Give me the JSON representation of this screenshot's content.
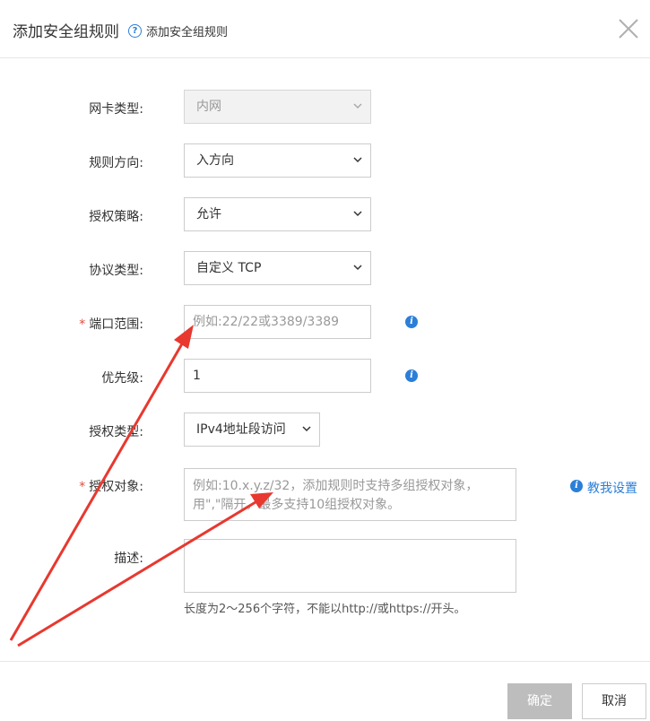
{
  "dialog": {
    "title": "添加安全组规则",
    "help_icon": "question-circle-icon",
    "help_text": "添加安全组规则"
  },
  "form": {
    "nic_type": {
      "label": "网卡类型:",
      "value": "内网"
    },
    "direction": {
      "label": "规则方向:",
      "value": "入方向"
    },
    "policy": {
      "label": "授权策略:",
      "value": "允许"
    },
    "protocol": {
      "label": "协议类型:",
      "value": "自定义 TCP"
    },
    "port_range": {
      "label": "端口范围:",
      "required": "*",
      "placeholder": "例如:22/22或3389/3389"
    },
    "priority": {
      "label": "优先级:",
      "value": "1"
    },
    "auth_type": {
      "label": "授权类型:",
      "value": "IPv4地址段访问"
    },
    "auth_object": {
      "label": "授权对象:",
      "required": "*",
      "placeholder_line1": "例如:10.x.y.z/32，添加规则时支持多组授权对象，",
      "placeholder_line2": "用\",\"隔开，最多支持10组授权对象。",
      "help_link": "教我设置"
    },
    "description": {
      "label": "描述:",
      "hint": "长度为2～256个字符，不能以http://或https://开头。"
    }
  },
  "footer": {
    "ok_label": "确定",
    "cancel_label": "取消"
  },
  "colors": {
    "accent": "#2b7fd8",
    "required": "#e24b3b",
    "arrow": "#e8382f",
    "disabled_button": "#bdbdbd"
  }
}
